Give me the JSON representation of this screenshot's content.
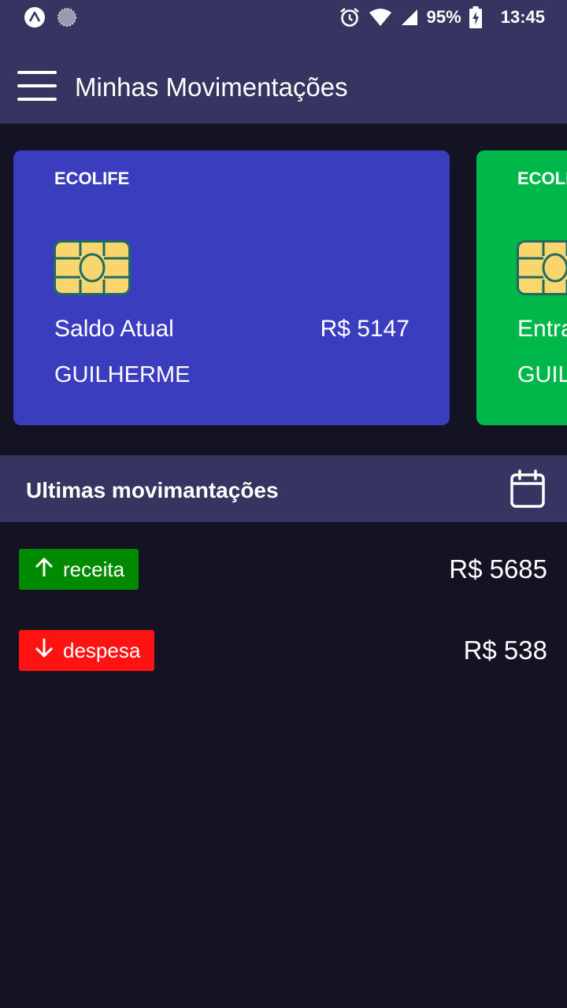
{
  "status_bar": {
    "battery": "95%",
    "time": "13:45",
    "icons": [
      "expo-icon",
      "sync-icon",
      "alarm-icon",
      "wifi-icon",
      "signal-icon",
      "battery-charging-icon"
    ]
  },
  "header": {
    "title": "Minhas Movimentações",
    "menu_icon": "hamburger-menu-icon"
  },
  "cards": [
    {
      "brand": "ECOLIFE",
      "label": "Saldo Atual",
      "value": "R$ 5147",
      "holder": "GUILHERME",
      "color": "#3a3dbd"
    },
    {
      "brand": "ECOLI",
      "label": "Entra",
      "value": "",
      "holder": "GUIL",
      "color": "#00b84a"
    }
  ],
  "section": {
    "title": "Ultimas movimantações",
    "calendar_icon": "calendar-icon"
  },
  "transactions": [
    {
      "type": "receita",
      "amount": "R$ 5685",
      "color": "#008a00",
      "icon": "arrow-up-icon"
    },
    {
      "type": "despesa",
      "amount": "R$ 538",
      "color": "#ff1212",
      "icon": "arrow-down-icon"
    }
  ],
  "colors": {
    "header_bg": "#363460",
    "page_bg": "#141324",
    "chip_gold": "#f8d66d",
    "chip_border": "#1e6b63"
  }
}
